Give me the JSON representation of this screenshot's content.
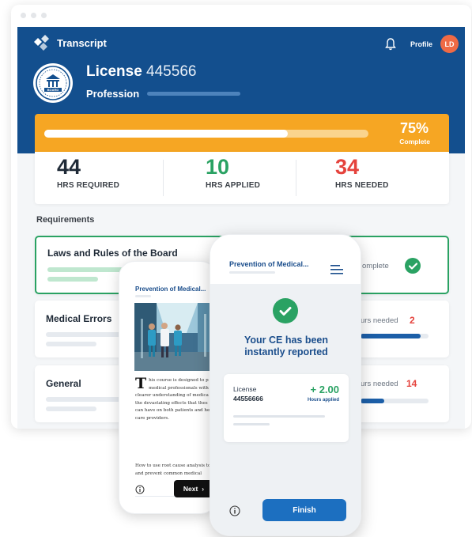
{
  "app": {
    "name": "Transcript",
    "profile_label": "Profile",
    "avatar_initials": "LD",
    "accent_color": "#134f8e"
  },
  "license": {
    "title": "License",
    "number": "445566",
    "profession_label": "Profession"
  },
  "progress": {
    "percent_label": "75%",
    "complete_label": "Complete",
    "fraction": 0.75,
    "color": "#f6a623"
  },
  "stats": {
    "required": {
      "value": "44",
      "label": "HRS REQUIRED"
    },
    "applied": {
      "value": "10",
      "label": "HRS APPLIED",
      "color": "#2aa263"
    },
    "needed": {
      "value": "34",
      "label": "HRS NEEDED",
      "color": "#e5433d"
    }
  },
  "requirements": {
    "title": "Requirements",
    "items": [
      {
        "name": "Laws and Rules of the Board",
        "status": "omplete",
        "state": "complete"
      },
      {
        "name": "Medical Errors",
        "status": "urs needed",
        "count": "2",
        "fill": 0.88
      },
      {
        "name": "General",
        "status": "urs needed",
        "count": "14",
        "fill": 0.35
      }
    ]
  },
  "phone_back": {
    "title": "Prevention of Medical...",
    "dropcap": "T",
    "paragraph1": "his course is designed to p medical professionals with clearer understanding of medica the devastating effects that thes can have on both patients and he care providers.",
    "paragraph2": "How to use root cause analysis to and prevent common medical",
    "next_label": "Next"
  },
  "phone_front": {
    "title": "Prevention of Medical...",
    "message_line1": "Your CE has been",
    "message_line2": "instantly reported",
    "license_label": "License",
    "license_number": "44556666",
    "hours": "+ 2.00",
    "hours_label": "Hours applied",
    "finish_label": "Finish"
  }
}
